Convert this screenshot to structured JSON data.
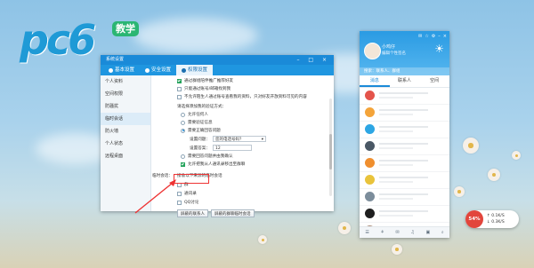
{
  "logo": {
    "text": "pc6",
    "tag": "教学"
  },
  "settings": {
    "title": "系统设置",
    "window_buttons": "– □ ×",
    "tabs": [
      {
        "label": "基本设置",
        "icon": "gear-icon"
      },
      {
        "label": "安全设置",
        "icon": "shield-icon"
      },
      {
        "label": "权限设置",
        "icon": "lock-icon",
        "active": true
      }
    ],
    "sidebar": [
      "个人资料",
      "空间权限",
      "防骚扰",
      "临时会话",
      "防火墙",
      "个人状态",
      "远程桌面"
    ],
    "active_sidebar": "临时会话",
    "options_top": [
      {
        "label": "通过群组陪伴推广推荐好友",
        "checked": true
      },
      {
        "label": "只能通过账号/邮箱找到我",
        "checked": false
      },
      {
        "label": "不允许陌生人通过账号查看我的资料，只对好友开放资料可见的内容",
        "checked": false
      }
    ],
    "verify_title": "请选择添加我的验证方式：",
    "verify_options": [
      {
        "label": "允许任何人",
        "selected": false
      },
      {
        "label": "需要验证信息",
        "selected": false
      },
      {
        "label": "需要正确回答问题",
        "selected": true
      }
    ],
    "question_label": "设置问题：",
    "question_value": "您的电话号码？",
    "answer_label": "设置答案：",
    "answer_value": "12",
    "more_options": [
      {
        "label": "需要回答问题并由我确认",
        "kind": "radio",
        "checked": false
      },
      {
        "label": "允许把我从人通讯录移出至群聊",
        "kind": "check",
        "checked": true
      }
    ],
    "temp_session_label": "临时会话：",
    "temp_session_title": "接收以下来源的临时会话",
    "temp_sources": [
      {
        "label": "群",
        "checked": false
      },
      {
        "label": "通讯录",
        "checked": false
      },
      {
        "label": "QQ讨论",
        "checked": false
      }
    ],
    "buttons": [
      "屏蔽的联系人",
      "屏蔽的群聊临时会话"
    ]
  },
  "qq": {
    "toolbar": [
      "✉",
      "☆",
      "⚙",
      "–",
      "×"
    ],
    "nickname": "小鸡仔",
    "signature": "编辑个性签名",
    "weather": "☀",
    "search_placeholder": "搜索：联系人、群组",
    "tabs": [
      "消息",
      "联系人",
      "空间"
    ],
    "contacts": [
      {
        "color": "#e4544b"
      },
      {
        "color": "#f4a43a"
      },
      {
        "color": "#2da6e4"
      },
      {
        "color": "#4a5865"
      },
      {
        "color": "#f08f2e"
      },
      {
        "color": "#e9c33b"
      },
      {
        "color": "#7c8d9b"
      },
      {
        "color": "#1f1f1f"
      },
      {
        "color": "#ab8d78"
      }
    ],
    "bottom_icons": [
      "☰",
      "⚘",
      "✉",
      "♫",
      "▣",
      "⌕"
    ]
  },
  "speed": {
    "percent": "54%",
    "up": "↑ 0.1K/S",
    "down": "↓ 0.3K/S"
  }
}
